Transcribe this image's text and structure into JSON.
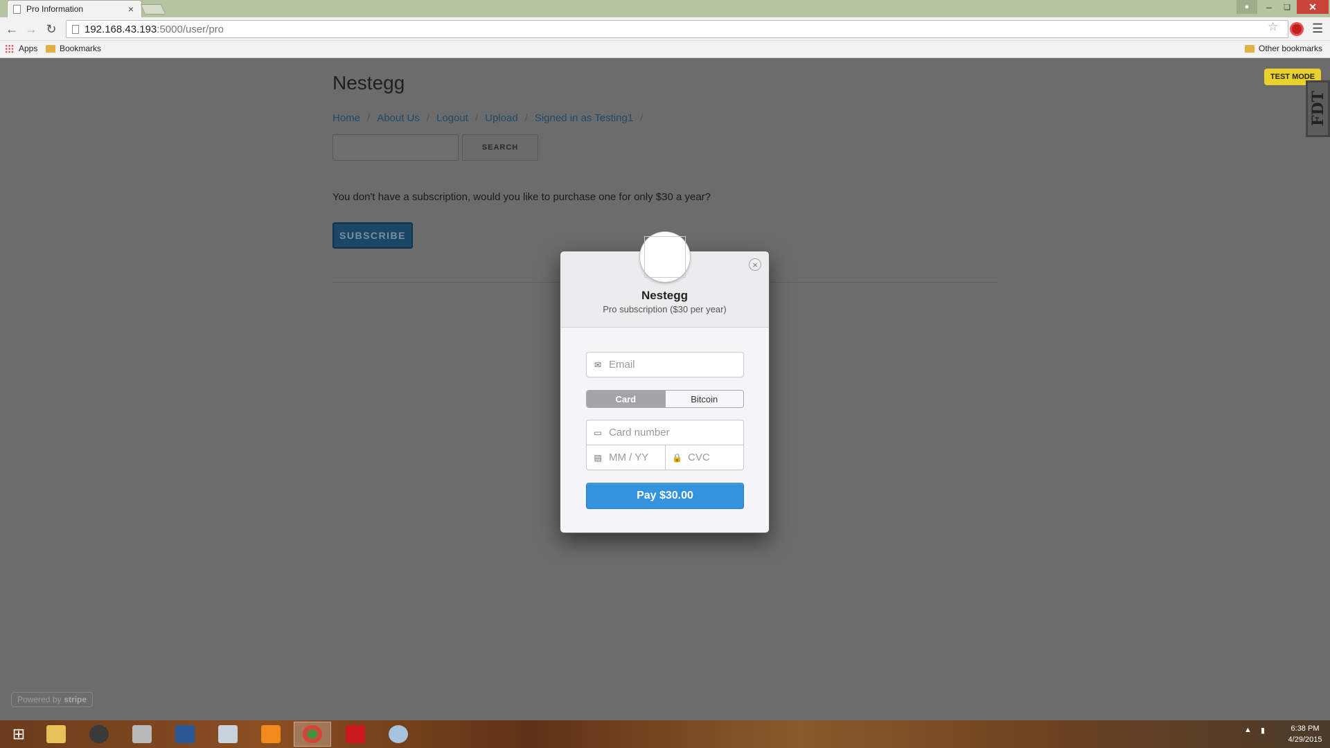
{
  "browser": {
    "tab_title": "Pro Information",
    "tab_close": "×",
    "url_host": "192.168.43.193",
    "url_path": ":5000/user/pro",
    "bookmarks": {
      "apps": "Apps",
      "bookmarks": "Bookmarks",
      "other": "Other bookmarks"
    },
    "icons": [
      "back-icon",
      "forward-icon",
      "reload-icon",
      "star-icon",
      "extension-icon",
      "menu-icon"
    ]
  },
  "page": {
    "site_title": "Nestegg",
    "nav": [
      {
        "label": "Home"
      },
      {
        "label": "About Us"
      },
      {
        "label": "Logout"
      },
      {
        "label": "Upload"
      },
      {
        "label": "Signed in as Testing1"
      }
    ],
    "nav_separator": "/",
    "search_button": "SEARCH",
    "subscription_message": "You don't have a subscription, would you like to purchase one for only $30 a year?",
    "subscribe_button": "SUBSCRIBE",
    "test_mode": "TEST MODE",
    "fdt_label": "FDT",
    "powered_by": "Powered by",
    "powered_brand": "stripe"
  },
  "checkout": {
    "merchant": "Nestegg",
    "description": "Pro subscription ($30 per year)",
    "close": "×",
    "email_placeholder": "Email",
    "tabs": {
      "card": "Card",
      "bitcoin": "Bitcoin"
    },
    "selected_tab": "Card",
    "card_placeholder": "Card number",
    "expiry_placeholder": "MM / YY",
    "cvc_placeholder": "CVC",
    "pay_button": "Pay $30.00"
  },
  "taskbar": {
    "time": "6:38 PM",
    "date": "4/29/2015"
  },
  "colors": {
    "overlay": "#6c6c6c",
    "pay_button": "#3393dc",
    "test_mode": "#e8d12a",
    "subscribe": "#1b4766",
    "tab_strip": "#b5c4a1"
  }
}
